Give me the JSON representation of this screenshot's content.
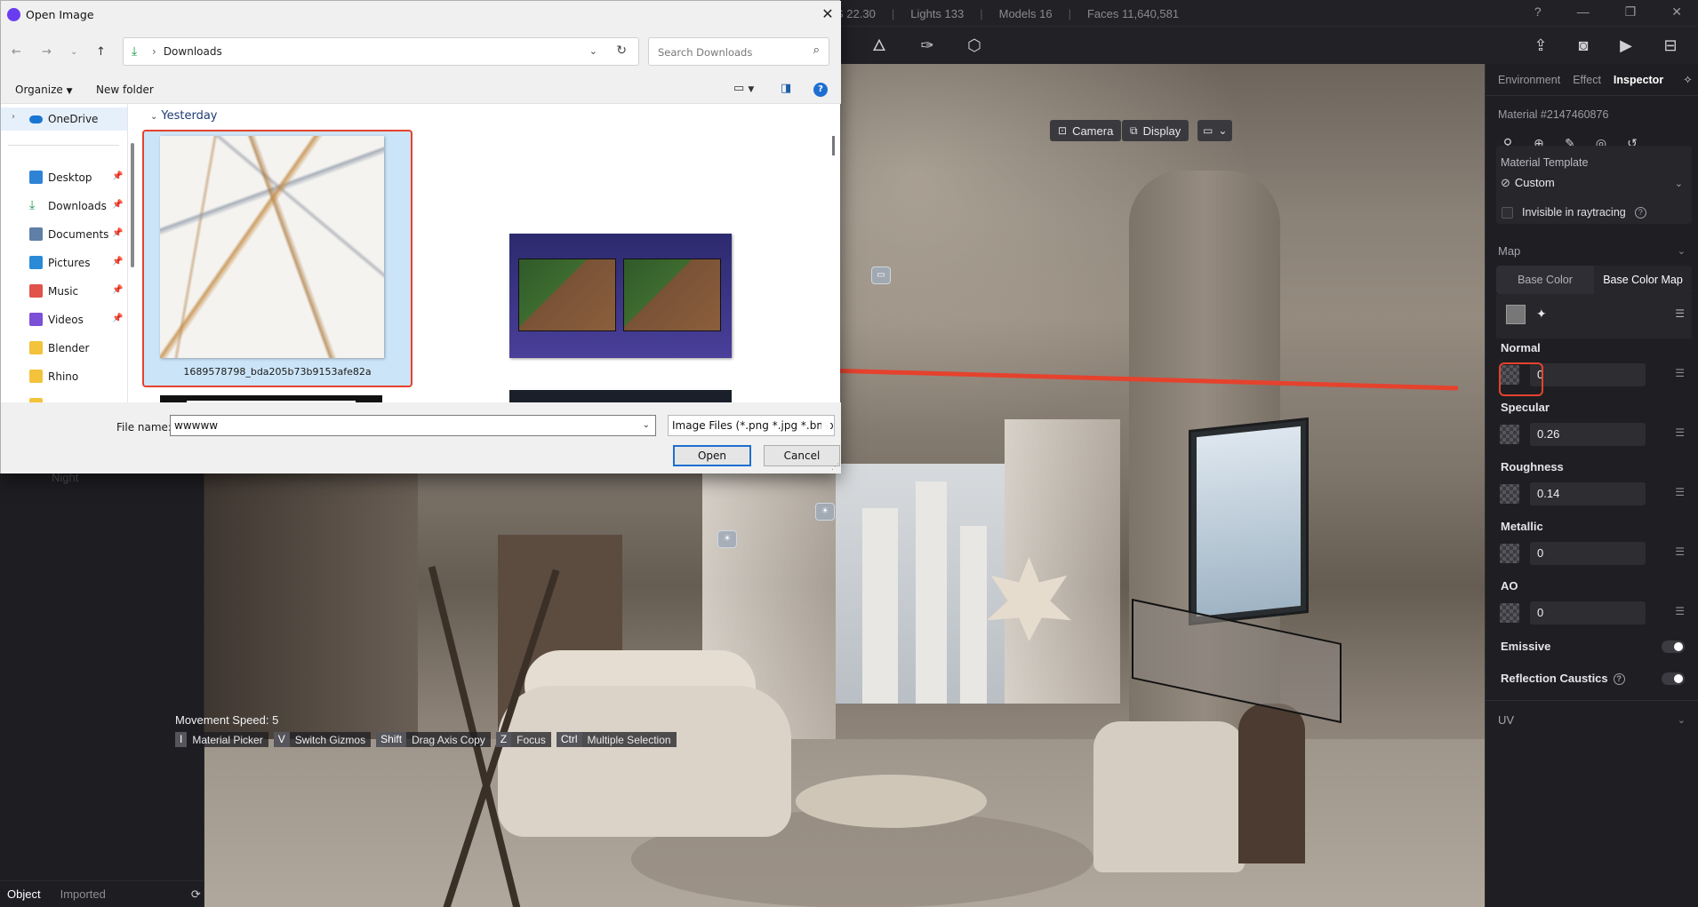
{
  "app": {
    "stats": {
      "partial": "S 22.30",
      "lights": "Lights 133",
      "models": "Models 16",
      "faces": "Faces 11,640,581"
    },
    "viewport_buttons": {
      "camera": "Camera",
      "display": "Display"
    },
    "movement_speed": "Movement Speed: 5",
    "shortcuts": [
      {
        "key": "I",
        "label": "Material Picker"
      },
      {
        "key": "V",
        "label": "Switch Gizmos"
      },
      {
        "key": "Shift",
        "label": "Drag Axis Copy"
      },
      {
        "key": "Z",
        "label": "Focus"
      },
      {
        "key": "Ctrl",
        "label": "Multiple Selection"
      }
    ],
    "left_footer": {
      "object": "Object",
      "imported": "Imported"
    },
    "left_partial": "Night"
  },
  "inspector": {
    "tabs": [
      "Environment",
      "Effect",
      "Inspector"
    ],
    "material_id": "Material #2147460876",
    "template_title": "Material Template",
    "template_value": "Custom",
    "invisible_label": "Invisible in raytracing",
    "map_title": "Map",
    "base_color_tabs": [
      "Base Color",
      "Base Color Map"
    ],
    "props": [
      {
        "label": "Normal",
        "value": "0"
      },
      {
        "label": "Specular",
        "value": "0.26"
      },
      {
        "label": "Roughness",
        "value": "0.14"
      },
      {
        "label": "Metallic",
        "value": "0"
      },
      {
        "label": "AO",
        "value": "0"
      }
    ],
    "emissive_label": "Emissive",
    "caustics_label": "Reflection Caustics",
    "uv_title": "UV"
  },
  "dialog": {
    "title": "Open Image",
    "breadcrumb": "Downloads",
    "search_placeholder": "Search Downloads",
    "organize": "Organize",
    "new_folder": "New folder",
    "nav": {
      "onedrive": "OneDrive",
      "items": [
        "Desktop",
        "Downloads",
        "Documents",
        "Pictures",
        "Music",
        "Videos",
        "Blender",
        "Rhino"
      ]
    },
    "group": "Yesterday",
    "selected_file": "1689578798_bda205b73b9153afe82a",
    "filename_label": "File name:",
    "filename_value": "wwwww",
    "filetype": "Image Files (*.png *.jpg *.bmp *",
    "open": "Open",
    "cancel": "Cancel"
  }
}
